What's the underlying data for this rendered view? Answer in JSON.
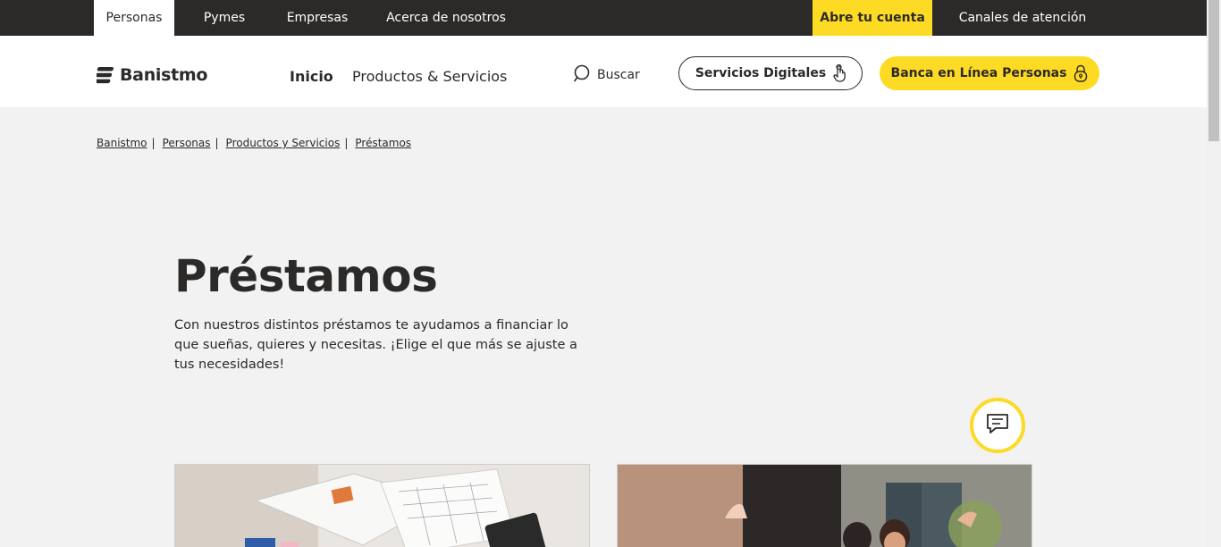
{
  "topbar": {
    "tabs": [
      {
        "label": "Personas"
      },
      {
        "label": "Pymes"
      },
      {
        "label": "Empresas"
      },
      {
        "label": "Acerca de nosotros"
      }
    ],
    "cta_label": "Abre tu cuenta",
    "channels_label": "Canales de atención"
  },
  "header": {
    "logo_text": "Banistmo",
    "nav": [
      {
        "label": "Inicio"
      },
      {
        "label": "Productos & Servicios"
      }
    ],
    "search_label": "Buscar",
    "digital_services_label": "Servicios Digitales",
    "online_banking_label": "Banca en Línea Personas"
  },
  "breadcrumb": [
    {
      "label": "Banistmo"
    },
    {
      "label": "Personas"
    },
    {
      "label": "Productos y Servicios"
    },
    {
      "label": "Préstamos"
    }
  ],
  "hero": {
    "title": "Préstamos",
    "intro": "Con nuestros distintos préstamos te ayudamos a financiar lo que sueñas, quieres y necesitas. ¡Elige el que más se ajuste a tus necesidades!"
  },
  "icons": {
    "search": "search-icon",
    "hand": "hand-pointer-icon",
    "lock": "lock-icon",
    "chat": "chat-icon",
    "logo": "logo-mark-icon"
  },
  "colors": {
    "brand_yellow": "#fdda24",
    "dark": "#2c2a29",
    "background": "#f2f2f2"
  }
}
